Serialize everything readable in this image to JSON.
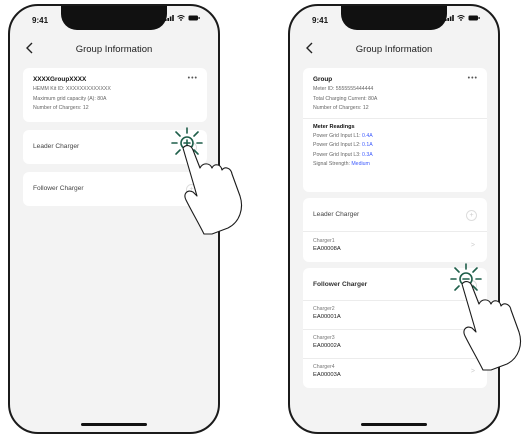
{
  "status_bar": {
    "time": "9:41"
  },
  "screen_left": {
    "title": "Group Information",
    "info": {
      "name": "XXXXGroupXXXX",
      "meter": "HEMM Kit ID: XXXXXXXXXXXXX",
      "capacity": "Maximum grid capacity (A): 80A",
      "count": "Number of Chargers: 12"
    },
    "more": "•••",
    "leader_label": "Leader Charger",
    "follower_label": "Follower Charger",
    "plus": "+"
  },
  "screen_right": {
    "title": "Group Information",
    "info": {
      "name": "Group",
      "meter": "Meter ID: 5555555444444",
      "current": "Total Charging Current: 80A",
      "count": "Number of Chargers: 12"
    },
    "more": "•••",
    "readings": {
      "title": "Meter Readings",
      "l1_label": "Power Grid Input L1: ",
      "l1_value": "0.4A",
      "l2_label": "Power Grid Input L2: ",
      "l2_value": "0.1A",
      "l3_label": "Power Grid Input L3: ",
      "l3_value": "0.3A",
      "signal_label": "Signal Strength: ",
      "signal_value": "Medium"
    },
    "leader_label": "Leader Charger",
    "leader_charger": {
      "name": "Charger1",
      "id": "EA00008A"
    },
    "follower_label": "Follower Charger",
    "followers": [
      {
        "name": "Charger2",
        "id": "EA00001A"
      },
      {
        "name": "Charger3",
        "id": "EA00002A"
      },
      {
        "name": "Charger4",
        "id": "EA00003A"
      }
    ],
    "plus": "+",
    "chevron": ">"
  },
  "colors": {
    "highlight": "#3d5afe",
    "tap_indicator": "#1f5f4a"
  }
}
